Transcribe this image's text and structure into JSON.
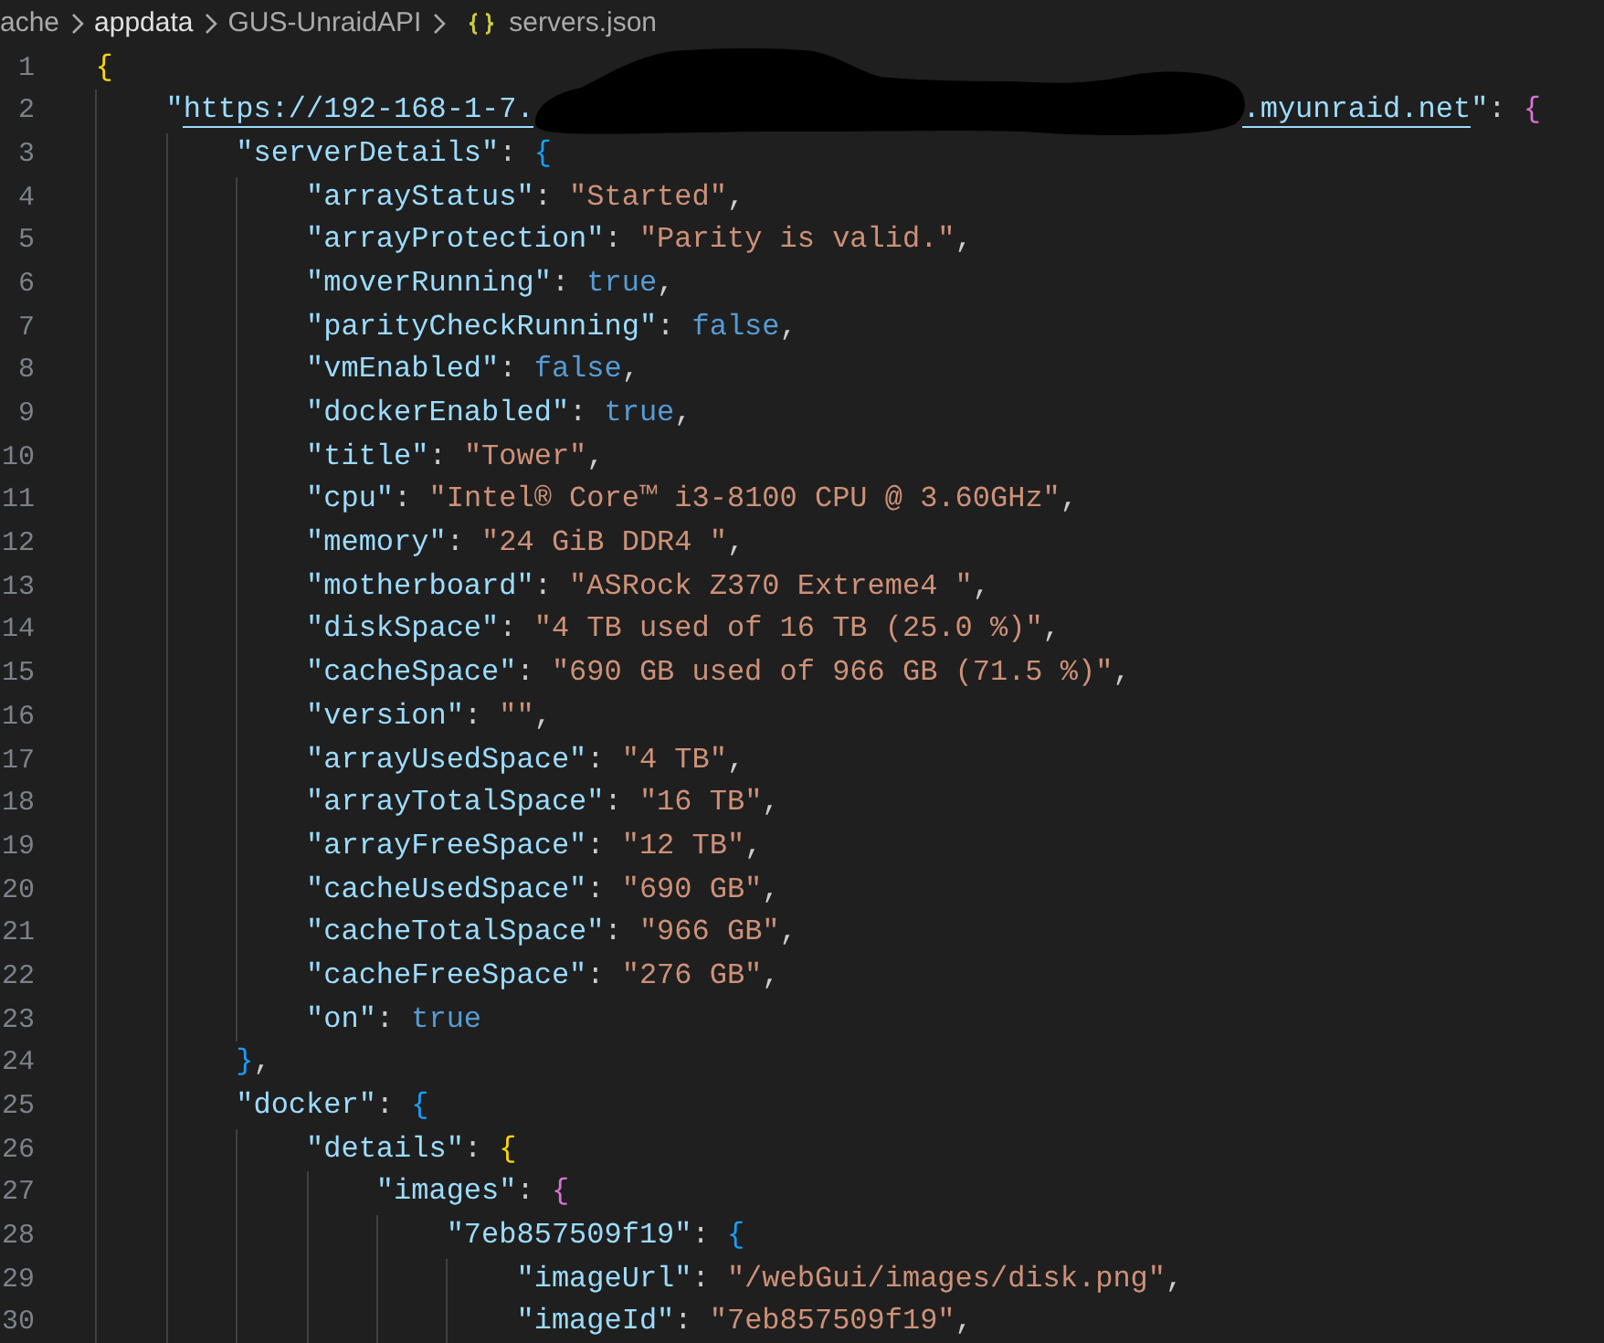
{
  "breadcrumbs": [
    {
      "label": "ache",
      "kind": "folder",
      "selected": false
    },
    {
      "label": "appdata",
      "kind": "folder",
      "selected": true
    },
    {
      "label": "GUS-UnraidAPI",
      "kind": "folder",
      "selected": false
    },
    {
      "label": "servers.json",
      "kind": "file",
      "selected": false
    }
  ],
  "editor": {
    "lines": [
      {
        "number": "1",
        "tokens": [
          {
            "kind": "bracket",
            "text": "{"
          }
        ],
        "children": [
          {
            "number": "2",
            "tokens": [
              {
                "kind": "key",
                "text": "\""
              },
              {
                "kind": "link",
                "parts": [
                  "https://192-168-1-7.",
                  ".myunraid.net"
                ],
                "redacted": true
              },
              {
                "kind": "key",
                "text": "\""
              },
              {
                "kind": "punct",
                "text": ": "
              },
              {
                "kind": "bracket",
                "text": "{"
              }
            ],
            "children": [
              {
                "number": "3",
                "tokens": [
                  {
                    "kind": "key",
                    "text": "\"serverDetails\""
                  },
                  {
                    "kind": "punct",
                    "text": ": "
                  },
                  {
                    "kind": "bracket",
                    "text": "{"
                  }
                ],
                "children": [
                  {
                    "number": "4",
                    "tokens": [
                      {
                        "kind": "key",
                        "text": "\"arrayStatus\""
                      },
                      {
                        "kind": "punct",
                        "text": ": "
                      },
                      {
                        "kind": "string",
                        "text": "\"Started\""
                      },
                      {
                        "kind": "punct",
                        "text": ","
                      }
                    ]
                  },
                  {
                    "number": "5",
                    "tokens": [
                      {
                        "kind": "key",
                        "text": "\"arrayProtection\""
                      },
                      {
                        "kind": "punct",
                        "text": ": "
                      },
                      {
                        "kind": "string",
                        "text": "\"Parity is valid.\""
                      },
                      {
                        "kind": "punct",
                        "text": ","
                      }
                    ]
                  },
                  {
                    "number": "6",
                    "tokens": [
                      {
                        "kind": "key",
                        "text": "\"moverRunning\""
                      },
                      {
                        "kind": "punct",
                        "text": ": "
                      },
                      {
                        "kind": "literal",
                        "text": "true"
                      },
                      {
                        "kind": "punct",
                        "text": ","
                      }
                    ]
                  },
                  {
                    "number": "7",
                    "tokens": [
                      {
                        "kind": "key",
                        "text": "\"parityCheckRunning\""
                      },
                      {
                        "kind": "punct",
                        "text": ": "
                      },
                      {
                        "kind": "literal",
                        "text": "false"
                      },
                      {
                        "kind": "punct",
                        "text": ","
                      }
                    ]
                  },
                  {
                    "number": "8",
                    "tokens": [
                      {
                        "kind": "key",
                        "text": "\"vmEnabled\""
                      },
                      {
                        "kind": "punct",
                        "text": ": "
                      },
                      {
                        "kind": "literal",
                        "text": "false"
                      },
                      {
                        "kind": "punct",
                        "text": ","
                      }
                    ]
                  },
                  {
                    "number": "9",
                    "tokens": [
                      {
                        "kind": "key",
                        "text": "\"dockerEnabled\""
                      },
                      {
                        "kind": "punct",
                        "text": ": "
                      },
                      {
                        "kind": "literal",
                        "text": "true"
                      },
                      {
                        "kind": "punct",
                        "text": ","
                      }
                    ]
                  },
                  {
                    "number": "10",
                    "tokens": [
                      {
                        "kind": "key",
                        "text": "\"title\""
                      },
                      {
                        "kind": "punct",
                        "text": ": "
                      },
                      {
                        "kind": "string",
                        "text": "\"Tower\""
                      },
                      {
                        "kind": "punct",
                        "text": ","
                      }
                    ]
                  },
                  {
                    "number": "11",
                    "tokens": [
                      {
                        "kind": "key",
                        "text": "\"cpu\""
                      },
                      {
                        "kind": "punct",
                        "text": ": "
                      },
                      {
                        "kind": "string",
                        "text": "\"Intel® Core™ i3-8100 CPU @ 3.60GHz\""
                      },
                      {
                        "kind": "punct",
                        "text": ","
                      }
                    ]
                  },
                  {
                    "number": "12",
                    "tokens": [
                      {
                        "kind": "key",
                        "text": "\"memory\""
                      },
                      {
                        "kind": "punct",
                        "text": ": "
                      },
                      {
                        "kind": "string",
                        "text": "\"24 GiB DDR4 \""
                      },
                      {
                        "kind": "punct",
                        "text": ","
                      }
                    ]
                  },
                  {
                    "number": "13",
                    "tokens": [
                      {
                        "kind": "key",
                        "text": "\"motherboard\""
                      },
                      {
                        "kind": "punct",
                        "text": ": "
                      },
                      {
                        "kind": "string",
                        "text": "\"ASRock Z370 Extreme4 \""
                      },
                      {
                        "kind": "punct",
                        "text": ","
                      }
                    ]
                  },
                  {
                    "number": "14",
                    "tokens": [
                      {
                        "kind": "key",
                        "text": "\"diskSpace\""
                      },
                      {
                        "kind": "punct",
                        "text": ": "
                      },
                      {
                        "kind": "string",
                        "text": "\"4 TB used of 16 TB (25.0 %)\""
                      },
                      {
                        "kind": "punct",
                        "text": ","
                      }
                    ]
                  },
                  {
                    "number": "15",
                    "tokens": [
                      {
                        "kind": "key",
                        "text": "\"cacheSpace\""
                      },
                      {
                        "kind": "punct",
                        "text": ": "
                      },
                      {
                        "kind": "string",
                        "text": "\"690 GB used of 966 GB (71.5 %)\""
                      },
                      {
                        "kind": "punct",
                        "text": ","
                      }
                    ]
                  },
                  {
                    "number": "16",
                    "tokens": [
                      {
                        "kind": "key",
                        "text": "\"version\""
                      },
                      {
                        "kind": "punct",
                        "text": ": "
                      },
                      {
                        "kind": "string",
                        "text": "\"\""
                      },
                      {
                        "kind": "punct",
                        "text": ","
                      }
                    ]
                  },
                  {
                    "number": "17",
                    "tokens": [
                      {
                        "kind": "key",
                        "text": "\"arrayUsedSpace\""
                      },
                      {
                        "kind": "punct",
                        "text": ": "
                      },
                      {
                        "kind": "string",
                        "text": "\"4 TB\""
                      },
                      {
                        "kind": "punct",
                        "text": ","
                      }
                    ]
                  },
                  {
                    "number": "18",
                    "tokens": [
                      {
                        "kind": "key",
                        "text": "\"arrayTotalSpace\""
                      },
                      {
                        "kind": "punct",
                        "text": ": "
                      },
                      {
                        "kind": "string",
                        "text": "\"16 TB\""
                      },
                      {
                        "kind": "punct",
                        "text": ","
                      }
                    ]
                  },
                  {
                    "number": "19",
                    "tokens": [
                      {
                        "kind": "key",
                        "text": "\"arrayFreeSpace\""
                      },
                      {
                        "kind": "punct",
                        "text": ": "
                      },
                      {
                        "kind": "string",
                        "text": "\"12 TB\""
                      },
                      {
                        "kind": "punct",
                        "text": ","
                      }
                    ]
                  },
                  {
                    "number": "20",
                    "tokens": [
                      {
                        "kind": "key",
                        "text": "\"cacheUsedSpace\""
                      },
                      {
                        "kind": "punct",
                        "text": ": "
                      },
                      {
                        "kind": "string",
                        "text": "\"690 GB\""
                      },
                      {
                        "kind": "punct",
                        "text": ","
                      }
                    ]
                  },
                  {
                    "number": "21",
                    "tokens": [
                      {
                        "kind": "key",
                        "text": "\"cacheTotalSpace\""
                      },
                      {
                        "kind": "punct",
                        "text": ": "
                      },
                      {
                        "kind": "string",
                        "text": "\"966 GB\""
                      },
                      {
                        "kind": "punct",
                        "text": ","
                      }
                    ]
                  },
                  {
                    "number": "22",
                    "tokens": [
                      {
                        "kind": "key",
                        "text": "\"cacheFreeSpace\""
                      },
                      {
                        "kind": "punct",
                        "text": ": "
                      },
                      {
                        "kind": "string",
                        "text": "\"276 GB\""
                      },
                      {
                        "kind": "punct",
                        "text": ","
                      }
                    ]
                  },
                  {
                    "number": "23",
                    "tokens": [
                      {
                        "kind": "key",
                        "text": "\"on\""
                      },
                      {
                        "kind": "punct",
                        "text": ": "
                      },
                      {
                        "kind": "literal",
                        "text": "true"
                      }
                    ]
                  }
                ]
              },
              {
                "number": "24",
                "tokens": [
                  {
                    "kind": "bracket",
                    "text": "}"
                  },
                  {
                    "kind": "punct",
                    "text": ","
                  }
                ]
              },
              {
                "number": "25",
                "tokens": [
                  {
                    "kind": "key",
                    "text": "\"docker\""
                  },
                  {
                    "kind": "punct",
                    "text": ": "
                  },
                  {
                    "kind": "bracket",
                    "text": "{"
                  }
                ],
                "children": [
                  {
                    "number": "26",
                    "tokens": [
                      {
                        "kind": "key",
                        "text": "\"details\""
                      },
                      {
                        "kind": "punct",
                        "text": ": "
                      },
                      {
                        "kind": "bracket",
                        "text": "{"
                      }
                    ],
                    "children": [
                      {
                        "number": "27",
                        "tokens": [
                          {
                            "kind": "key",
                            "text": "\"images\""
                          },
                          {
                            "kind": "punct",
                            "text": ": "
                          },
                          {
                            "kind": "bracket",
                            "text": "{"
                          }
                        ],
                        "children": [
                          {
                            "number": "28",
                            "tokens": [
                              {
                                "kind": "key",
                                "text": "\"7eb857509f19\""
                              },
                              {
                                "kind": "punct",
                                "text": ": "
                              },
                              {
                                "kind": "bracket",
                                "text": "{"
                              }
                            ],
                            "children": [
                              {
                                "number": "29",
                                "tokens": [
                                  {
                                    "kind": "key",
                                    "text": "\"imageUrl\""
                                  },
                                  {
                                    "kind": "punct",
                                    "text": ": "
                                  },
                                  {
                                    "kind": "string",
                                    "text": "\"/webGui/images/disk.png\""
                                  },
                                  {
                                    "kind": "punct",
                                    "text": ","
                                  }
                                ]
                              },
                              {
                                "number": "30",
                                "tokens": [
                                  {
                                    "kind": "key",
                                    "text": "\"imageId\""
                                  },
                                  {
                                    "kind": "punct",
                                    "text": ": "
                                  },
                                  {
                                    "kind": "string",
                                    "text": "\"7eb857509f19\""
                                  },
                                  {
                                    "kind": "punct",
                                    "text": ","
                                  }
                                ]
                              }
                            ]
                          }
                        ]
                      }
                    ]
                  }
                ]
              }
            ]
          }
        ]
      }
    ]
  }
}
